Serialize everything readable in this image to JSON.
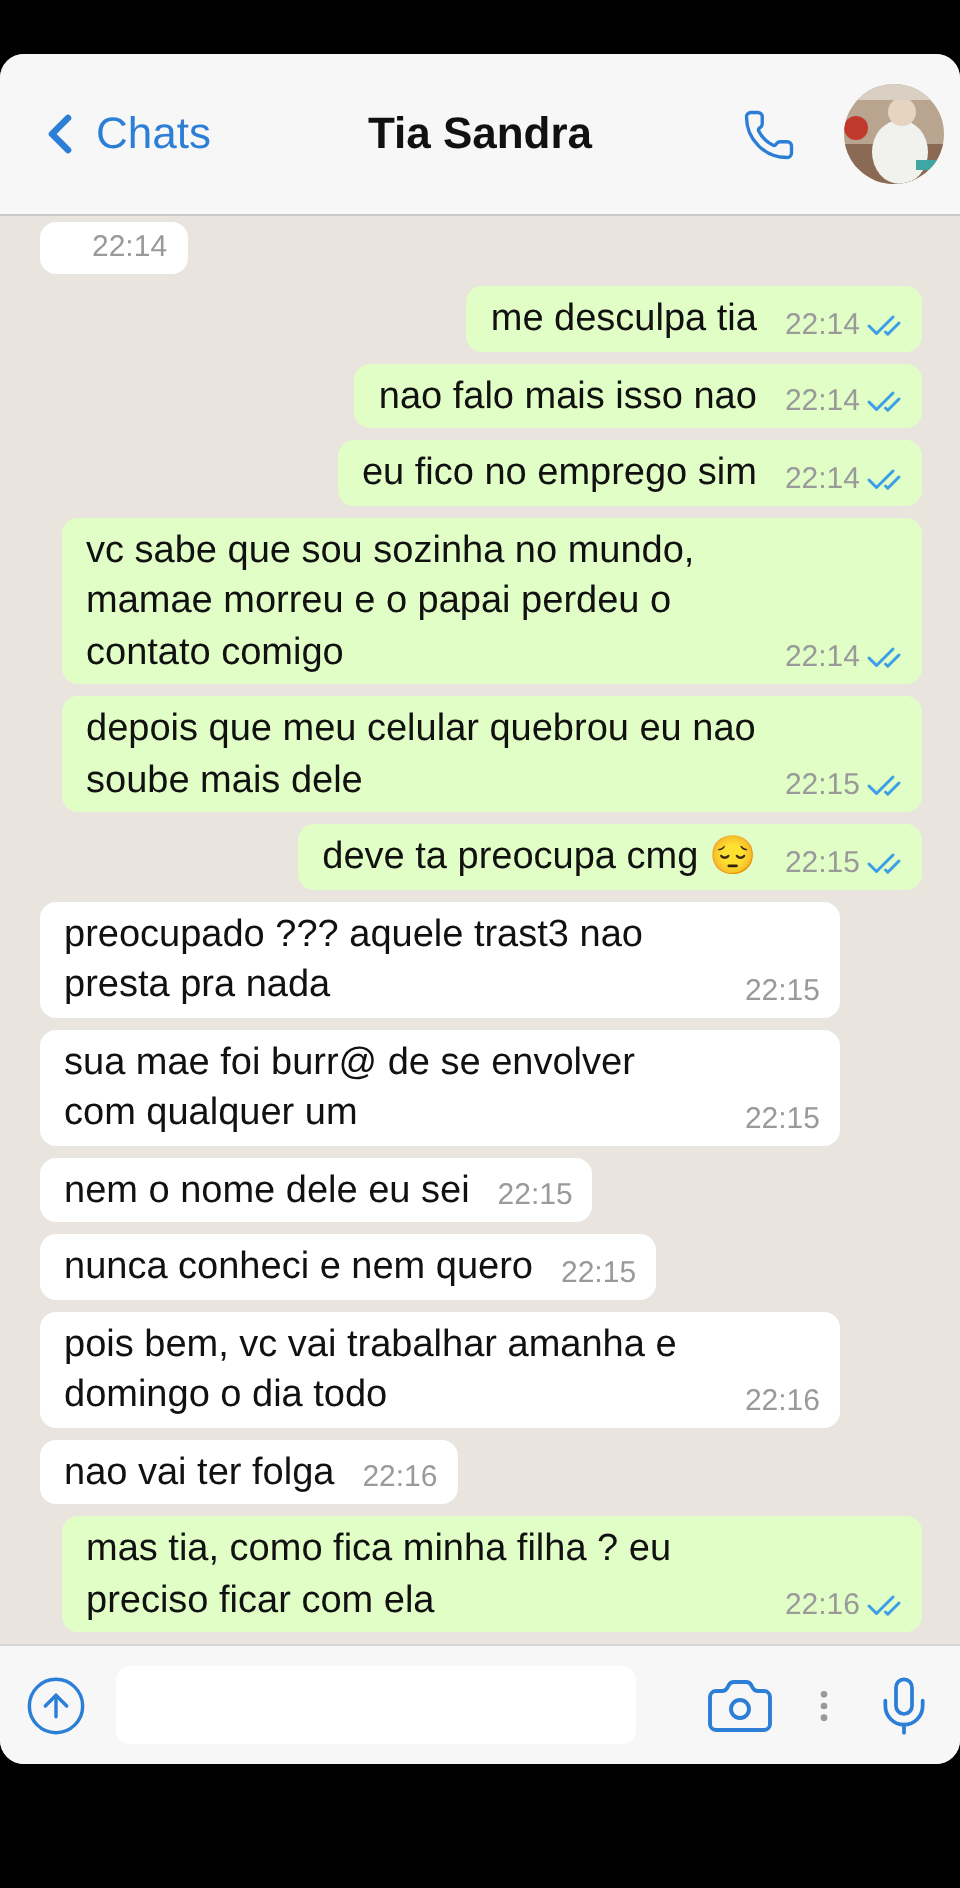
{
  "header": {
    "back_label": "Chats",
    "title": "Tia Sandra"
  },
  "messages": [
    {
      "kind": "received",
      "time": "22:14"
    },
    {
      "kind": "sent",
      "text": "me desculpa tia",
      "time": "22:14",
      "read": true
    },
    {
      "kind": "sent",
      "text": "nao falo mais isso nao",
      "time": "22:14",
      "read": true
    },
    {
      "kind": "sent",
      "text": "eu fico no emprego sim",
      "time": "22:14",
      "read": true
    },
    {
      "kind": "sent",
      "text": "vc sabe que sou sozinha no mundo, mamae morreu e o papai perdeu o contato comigo",
      "time": "22:14",
      "read": true
    },
    {
      "kind": "sent",
      "text": "depois que meu celular quebrou eu nao soube mais dele",
      "time": "22:15",
      "read": true
    },
    {
      "kind": "sent",
      "text": "deve ta preocupa cmg 😔",
      "time": "22:15",
      "read": true
    },
    {
      "kind": "received",
      "text": "preocupado ??? aquele trast3 nao presta pra nada",
      "time": "22:15"
    },
    {
      "kind": "received",
      "text": "sua mae foi burr@ de se envolver com qualquer um",
      "time": "22:15"
    },
    {
      "kind": "received",
      "text": "nem o nome dele eu sei",
      "time": "22:15"
    },
    {
      "kind": "received",
      "text": "nunca conheci e nem quero",
      "time": "22:15"
    },
    {
      "kind": "received",
      "text": "pois bem, vc vai trabalhar amanha e domingo o dia todo",
      "time": "22:16"
    },
    {
      "kind": "received",
      "text": "nao vai ter folga",
      "time": "22:16"
    },
    {
      "kind": "sent",
      "text": "mas tia, como fica minha filha ? eu preciso ficar com ela",
      "time": "22:16",
      "read": true
    }
  ]
}
